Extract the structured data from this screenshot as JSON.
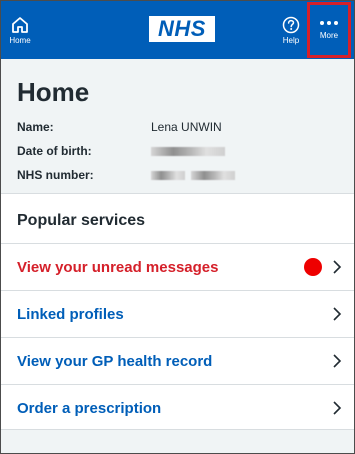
{
  "topbar": {
    "home_label": "Home",
    "logo_text": "NHS",
    "help_label": "Help",
    "more_label": "More"
  },
  "header": {
    "title": "Home",
    "name_label": "Name:",
    "name_value": "Lena UNWIN",
    "dob_label": "Date of birth:",
    "nhs_label": "NHS number:"
  },
  "services": {
    "title": "Popular services",
    "items": [
      {
        "label": "View your unread messages",
        "alert": true
      },
      {
        "label": "Linked profiles"
      },
      {
        "label": "View your GP health record"
      },
      {
        "label": "Order a prescription"
      }
    ]
  },
  "colors": {
    "brand": "#005eb8",
    "alert": "#d5202a",
    "highlight_box": "#d5202a"
  }
}
